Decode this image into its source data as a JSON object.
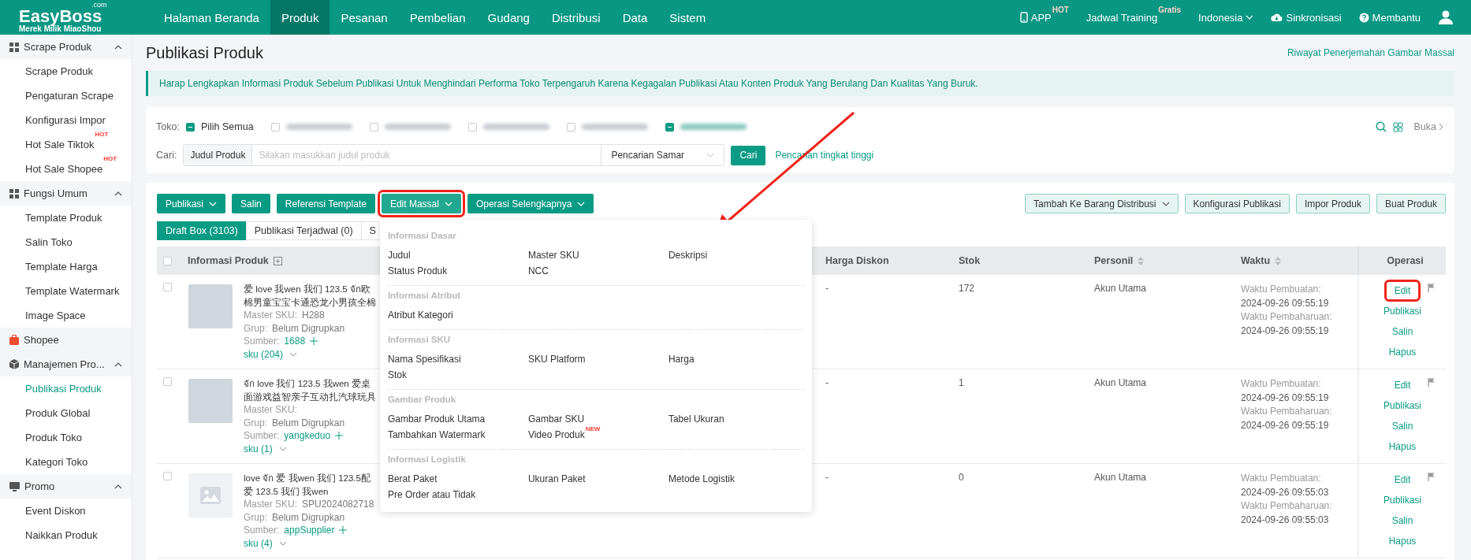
{
  "header": {
    "logo": {
      "name": "EasyBoss",
      "suffix": ".com",
      "tagline": "Merek Milik MiaoShou"
    },
    "nav": [
      {
        "label": "Halaman Beranda",
        "selected": false
      },
      {
        "label": "Produk",
        "selected": true
      },
      {
        "label": "Pesanan",
        "selected": false
      },
      {
        "label": "Pembelian",
        "selected": false
      },
      {
        "label": "Gudang",
        "selected": false
      },
      {
        "label": "Distribusi",
        "selected": false
      },
      {
        "label": "Data",
        "selected": false
      },
      {
        "label": "Sistem",
        "selected": false
      }
    ],
    "right": [
      {
        "kind": "app",
        "label": "APP",
        "badge": "HOT"
      },
      {
        "kind": "plain",
        "label": "Jadwal Training",
        "badge": "Gratis"
      },
      {
        "kind": "dropdown",
        "label": "Indonesia"
      },
      {
        "kind": "cloud",
        "label": "Sinkronisasi"
      },
      {
        "kind": "help",
        "label": "Membantu"
      },
      {
        "kind": "user"
      }
    ]
  },
  "sidebar": {
    "groups": [
      {
        "kind": "section",
        "label": "Scrape Produk",
        "expanded": true,
        "items": [
          {
            "label": "Scrape Produk",
            "selected": false
          },
          {
            "label": "Pengaturan Scrape",
            "selected": false
          },
          {
            "label": "Konfigurasi Impor",
            "selected": false
          },
          {
            "label": "Hot Sale Tiktok",
            "badge": "HOT",
            "selected": false
          },
          {
            "label": "Hot Sale Shopee",
            "badge": "HOT",
            "selected": false
          }
        ]
      },
      {
        "kind": "section",
        "label": "Fungsi Umum",
        "expanded": true,
        "items": [
          {
            "label": "Template Produk",
            "selected": false
          },
          {
            "label": "Salin Toko",
            "selected": false
          },
          {
            "label": "Template Harga",
            "selected": false
          },
          {
            "label": "Template Watermark",
            "selected": false
          },
          {
            "label": "Image Space",
            "selected": false
          }
        ]
      },
      {
        "kind": "link",
        "label": "Shopee"
      },
      {
        "kind": "section",
        "label": "Manajemen Pro...",
        "expanded": true,
        "items": [
          {
            "label": "Publikasi Produk",
            "selected": true
          },
          {
            "label": "Produk Global",
            "selected": false
          },
          {
            "label": "Produk Toko",
            "selected": false
          },
          {
            "label": "Kategori Toko",
            "selected": false
          }
        ]
      },
      {
        "kind": "section",
        "label": "Promo",
        "expanded": true,
        "items": [
          {
            "label": "Event Diskon",
            "selected": false
          },
          {
            "label": "Naikkan Produk",
            "selected": false
          }
        ]
      }
    ]
  },
  "page": {
    "title": "Publikasi Produk",
    "history_link": "Riwayat Penerjemahan Gambar Massal",
    "notice": "Harap Lengkapkan Informasi Produk Sebelum Publikasi Untuk Menghindari Performa Toko Terpengaruh Karena Kegagalan Publikasi Atau Konten Produk Yang Berulang Dan Kualitas Yang Buruk."
  },
  "filter": {
    "toko_label": "Toko:",
    "select_all": {
      "label": "Pilih Semua",
      "checked": true
    },
    "stores": [
      {
        "checked": false
      },
      {
        "checked": false
      },
      {
        "checked": false
      },
      {
        "checked": false
      },
      {
        "checked": true
      }
    ],
    "open_label": "Buka",
    "search_label": "Cari:",
    "field_type": "Judul Produk",
    "placeholder": "Silakan masukkan judul produk",
    "mode": "Pencarian Samar",
    "search_button": "Cari",
    "advanced_link": "Pencarian tingkat tinggi"
  },
  "toolbar": {
    "left": [
      {
        "label": "Publikasi",
        "dropdown": true,
        "annotated": false
      },
      {
        "label": "Salin",
        "dropdown": false,
        "annotated": false
      },
      {
        "label": "Referensi Template",
        "dropdown": false,
        "annotated": false
      },
      {
        "label": "Edit Massal",
        "dropdown": true,
        "annotated": true
      },
      {
        "label": "Operasi Selengkapnya",
        "dropdown": true,
        "annotated": false
      }
    ],
    "right": [
      {
        "label": "Tambah Ke Barang Distribusi",
        "dropdown": true
      },
      {
        "label": "Konfigurasi Publikasi",
        "dropdown": false
      },
      {
        "label": "Impor Produk",
        "dropdown": false
      },
      {
        "label": "Buat Produk",
        "dropdown": false
      }
    ]
  },
  "tabs": [
    {
      "label": "Draft Box (3103)",
      "selected": true
    },
    {
      "label": "Publikasi Terjadwal (0)",
      "selected": false
    },
    {
      "label": "S",
      "selected": false
    }
  ],
  "mass_edit_menu": {
    "sections": [
      {
        "title": "Informasi Dasar",
        "items": [
          {
            "label": "Judul"
          },
          {
            "label": "Master SKU"
          },
          {
            "label": "Deskripsi"
          },
          {
            "label": "Status Produk"
          },
          {
            "label": "NCC"
          }
        ]
      },
      {
        "title": "Informasi Atribut",
        "items": [
          {
            "label": "Atribut Kategori"
          }
        ]
      },
      {
        "title": "Informasi SKU",
        "items": [
          {
            "label": "Nama Spesifikasi"
          },
          {
            "label": "SKU Platform"
          },
          {
            "label": "Harga"
          },
          {
            "label": "Stok"
          }
        ]
      },
      {
        "title": "Gambar Produk",
        "items": [
          {
            "label": "Gambar Produk Utama"
          },
          {
            "label": "Gambar SKU"
          },
          {
            "label": "Tabel Ukuran"
          },
          {
            "label": "Tambahkan Watermark"
          },
          {
            "label": "Video Produk",
            "badge": "NEW"
          }
        ]
      },
      {
        "title": "Informasi Logistik",
        "items": [
          {
            "label": "Berat Paket"
          },
          {
            "label": "Ukuran Paket"
          },
          {
            "label": "Metode Logistik"
          },
          {
            "label": "Pre Order atau Tidak"
          }
        ]
      }
    ]
  },
  "table": {
    "header_checked": false,
    "columns": [
      {
        "label": "Informasi Produk",
        "kind": "expand"
      },
      {
        "label": "Harga Diskon",
        "kind": "plain"
      },
      {
        "label": "Stok",
        "kind": "plain"
      },
      {
        "label": "Personil",
        "kind": "sort"
      },
      {
        "label": "Waktu",
        "kind": "sort"
      },
      {
        "label": "Operasi",
        "kind": "center"
      }
    ],
    "rows": [
      {
        "checked": false,
        "kind": "photo",
        "title_lines": [
          "爱 love 我wen 我们 123.5 จัก欧",
          "棉男童宝宝卡通恐龙小男孩全棉"
        ],
        "master_sku_label": "Master SKU:",
        "master_sku": "H288",
        "group_label": "Grup:",
        "group": "Belum Digrupkan",
        "source_label": "Sumber:",
        "source": "1688",
        "sku": "sku (204)",
        "discount": "-",
        "stock": "172",
        "person": "Akun Utama",
        "created_label": "Waktu Pembuatan:",
        "created": "2024-09-26 09:55:19",
        "updated_label": "Waktu Pembaharuan:",
        "updated": "2024-09-26 09:55:19",
        "actions": [
          {
            "label": "Edit",
            "annotated": true
          },
          {
            "label": "Publikasi",
            "annotated": false
          },
          {
            "label": "Salin",
            "annotated": false
          },
          {
            "label": "Hapus",
            "annotated": false
          }
        ]
      },
      {
        "checked": false,
        "kind": "photo",
        "title_lines": [
          "จัก love 我们 123.5 我wen 爱桌",
          "面游戏益智亲子互动扎汽球玩具"
        ],
        "master_sku_label": "Master SKU:",
        "group_label": "Grup:",
        "group": "Belum Digrupkan",
        "source_label": "Sumber:",
        "source": "yangkeduo",
        "sku": "sku (1)",
        "discount": "-",
        "stock": "1",
        "person": "Akun Utama",
        "created_label": "Waktu Pembuatan:",
        "created": "2024-09-26 09:55:19",
        "updated_label": "Waktu Pembaharuan:",
        "updated": "2024-09-26 09:55:19",
        "actions": [
          {
            "label": "Edit",
            "annotated": false
          },
          {
            "label": "Publikasi",
            "annotated": false
          },
          {
            "label": "Salin",
            "annotated": false
          },
          {
            "label": "Hapus",
            "annotated": false
          }
        ]
      },
      {
        "checked": false,
        "kind": "placeholder",
        "title_lines": [
          "love จัก 爱 我wen 我们 123.5配",
          "爱 123.5 我们 我wen"
        ],
        "master_sku_label": "Master SKU:",
        "master_sku": "SPU2024082718",
        "group_label": "Grup:",
        "group": "Belum Digrupkan",
        "source_label": "Sumber:",
        "source": "appSupplier",
        "sku": "sku (4)",
        "discount": "-",
        "stock": "0",
        "person": "Akun Utama",
        "created_label": "Waktu Pembuatan:",
        "created": "2024-09-26 09:55:03",
        "updated_label": "Waktu Pembaharuan:",
        "updated": "2024-09-26 09:55:03",
        "actions": [
          {
            "label": "Edit",
            "annotated": false
          },
          {
            "label": "Publikasi",
            "annotated": false
          },
          {
            "label": "Salin",
            "annotated": false
          },
          {
            "label": "Hapus",
            "annotated": false
          }
        ]
      }
    ]
  }
}
